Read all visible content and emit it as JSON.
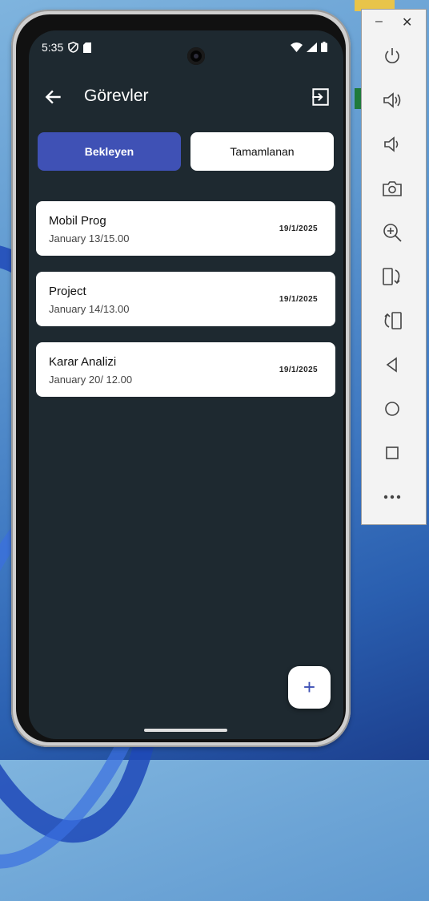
{
  "status_bar": {
    "time": "5:35"
  },
  "appbar": {
    "title": "Görevler"
  },
  "tabs": {
    "pending_label": "Bekleyen",
    "done_label": "Tamamlanan"
  },
  "tasks": [
    {
      "name": "Mobil Prog",
      "time": "January 13/15.00",
      "date": "19/1/2025"
    },
    {
      "name": "Project",
      "time": "January 14/13.00",
      "date": "19/1/2025"
    },
    {
      "name": "Karar Analizi",
      "time": "January 20/ 12.00",
      "date": "19/1/2025"
    }
  ],
  "fab": {
    "label": "+"
  },
  "colors": {
    "background": "#1e2930",
    "accent": "#3f51b5",
    "card": "#ffffff"
  },
  "emulator_panel": {
    "buttons": [
      "power-icon",
      "volume-up-icon",
      "volume-down-icon",
      "camera-icon",
      "zoom-in-icon",
      "rotate-left-icon",
      "rotate-right-icon",
      "back-icon",
      "home-icon",
      "overview-icon",
      "more-icon"
    ]
  }
}
